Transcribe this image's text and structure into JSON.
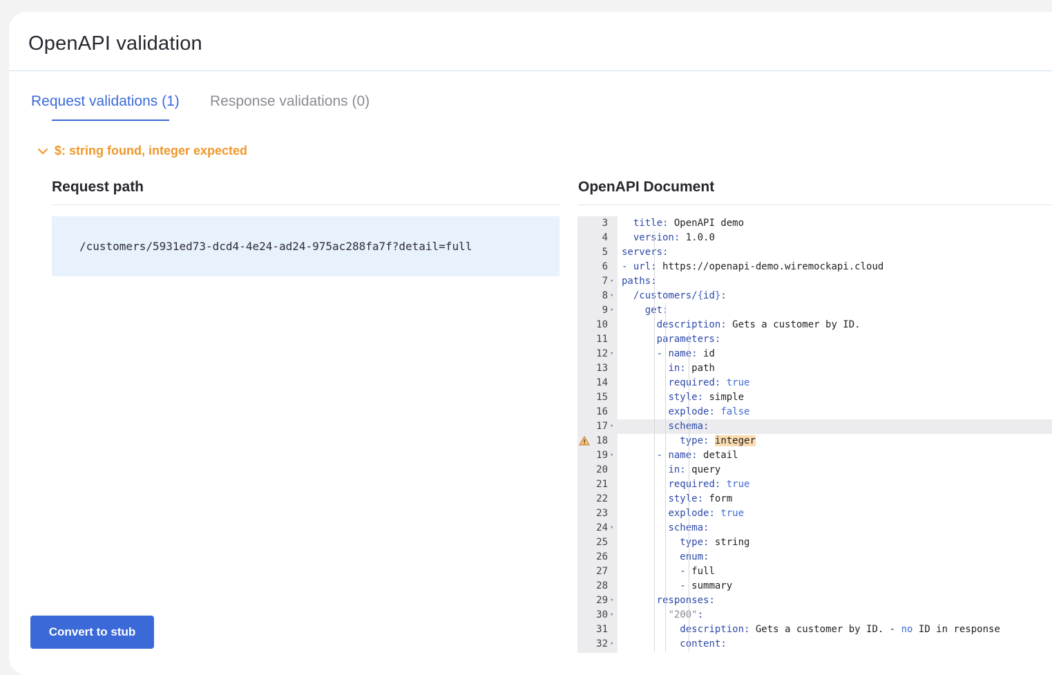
{
  "header": {
    "title": "OpenAPI validation"
  },
  "tabs": [
    {
      "label": "Request validations (1)",
      "active": true
    },
    {
      "label": "Response validations (0)",
      "active": false
    }
  ],
  "issue": {
    "message": "$: string found, integer expected",
    "expanded": true,
    "icon": "chevron-down-icon"
  },
  "request": {
    "heading": "Request path",
    "path": "/customers/5931ed73-dcd4-4e24-ad24-975ac288fa7f?detail=full"
  },
  "document": {
    "heading": "OpenAPI Document",
    "active_line": 17,
    "warning_line": 18,
    "lines": [
      {
        "n": "3",
        "fold": false,
        "text": "  title: OpenAPI demo"
      },
      {
        "n": "4",
        "fold": false,
        "text": "  version: 1.0.0"
      },
      {
        "n": "5",
        "fold": false,
        "text": "servers:"
      },
      {
        "n": "6",
        "fold": false,
        "text": "- url: https://openapi-demo.wiremockapi.cloud"
      },
      {
        "n": "7",
        "fold": true,
        "text": "paths:"
      },
      {
        "n": "8",
        "fold": true,
        "text": "  /customers/{id}:"
      },
      {
        "n": "9",
        "fold": true,
        "text": "    get:"
      },
      {
        "n": "10",
        "fold": false,
        "text": "      description: Gets a customer by ID."
      },
      {
        "n": "11",
        "fold": false,
        "text": "      parameters:"
      },
      {
        "n": "12",
        "fold": true,
        "text": "      - name: id"
      },
      {
        "n": "13",
        "fold": false,
        "text": "        in: path"
      },
      {
        "n": "14",
        "fold": false,
        "text": "        required: true"
      },
      {
        "n": "15",
        "fold": false,
        "text": "        style: simple"
      },
      {
        "n": "16",
        "fold": false,
        "text": "        explode: false"
      },
      {
        "n": "17",
        "fold": true,
        "text": "        schema:"
      },
      {
        "n": "18",
        "fold": false,
        "text": "          type: integer"
      },
      {
        "n": "19",
        "fold": true,
        "text": "      - name: detail"
      },
      {
        "n": "20",
        "fold": false,
        "text": "        in: query"
      },
      {
        "n": "21",
        "fold": false,
        "text": "        required: true"
      },
      {
        "n": "22",
        "fold": false,
        "text": "        style: form"
      },
      {
        "n": "23",
        "fold": false,
        "text": "        explode: true"
      },
      {
        "n": "24",
        "fold": true,
        "text": "        schema:"
      },
      {
        "n": "25",
        "fold": false,
        "text": "          type: string"
      },
      {
        "n": "26",
        "fold": false,
        "text": "          enum:"
      },
      {
        "n": "27",
        "fold": false,
        "text": "          - full"
      },
      {
        "n": "28",
        "fold": false,
        "text": "          - summary"
      },
      {
        "n": "29",
        "fold": true,
        "text": "      responses:"
      },
      {
        "n": "30",
        "fold": true,
        "text": "        \"200\":"
      },
      {
        "n": "31",
        "fold": false,
        "text": "          description: Gets a customer by ID. - no ID in response"
      },
      {
        "n": "32",
        "fold": true,
        "text": "          content:"
      }
    ]
  },
  "actions": {
    "convert_label": "Convert to stub"
  },
  "colors": {
    "accent": "#3b6ad8",
    "warning": "#f0982c",
    "request_bg": "#e8f2fc",
    "highlight": "#fbdcb0"
  }
}
